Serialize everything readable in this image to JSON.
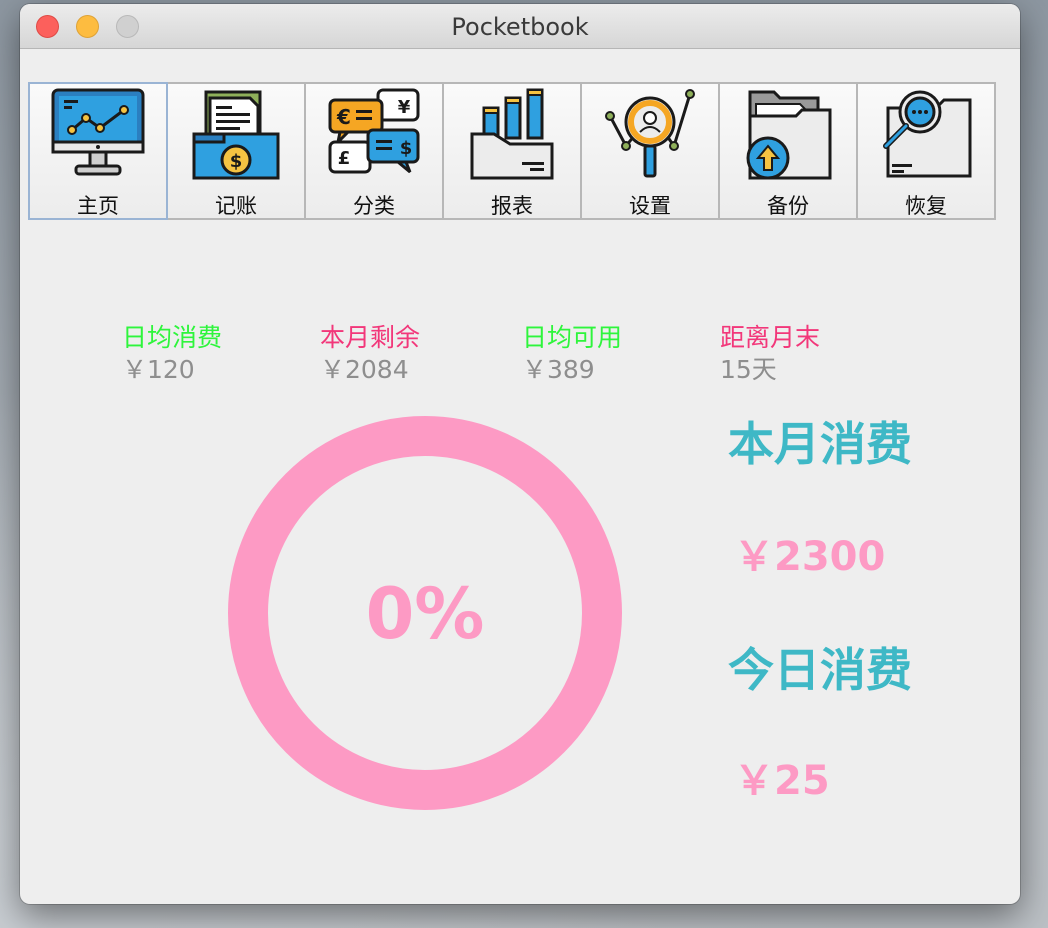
{
  "window": {
    "title": "Pocketbook"
  },
  "toolbar": {
    "items": [
      {
        "label": "主页",
        "icon": "monitor-chart-icon"
      },
      {
        "label": "记账",
        "icon": "document-coin-icon"
      },
      {
        "label": "分类",
        "icon": "currency-chat-icon"
      },
      {
        "label": "报表",
        "icon": "factory-report-icon"
      },
      {
        "label": "设置",
        "icon": "magnifier-network-icon"
      },
      {
        "label": "备份",
        "icon": "folder-upload-icon"
      },
      {
        "label": "恢复",
        "icon": "folder-search-icon"
      }
    ]
  },
  "stats": [
    {
      "label": "日均消费",
      "value": "￥120",
      "color": "#2ef53c"
    },
    {
      "label": "本月剩余",
      "value": "￥2084",
      "color": "#f2377a"
    },
    {
      "label": "日均可用",
      "value": "￥389",
      "color": "#2ef53c"
    },
    {
      "label": "距离月末",
      "value": "15天",
      "color": "#f2377a"
    }
  ],
  "progress": {
    "percent_text": "0%",
    "fraction": 0.0,
    "color": "#fd9ac4"
  },
  "summary": {
    "month_label": "本月消费",
    "month_value": "￥2300",
    "today_label": "今日消费",
    "today_value": "￥25"
  },
  "colors": {
    "accent_cyan": "#3eb8c6",
    "accent_pink": "#fd9ac4",
    "accent_green": "#2ef53c",
    "accent_red": "#f2377a"
  }
}
